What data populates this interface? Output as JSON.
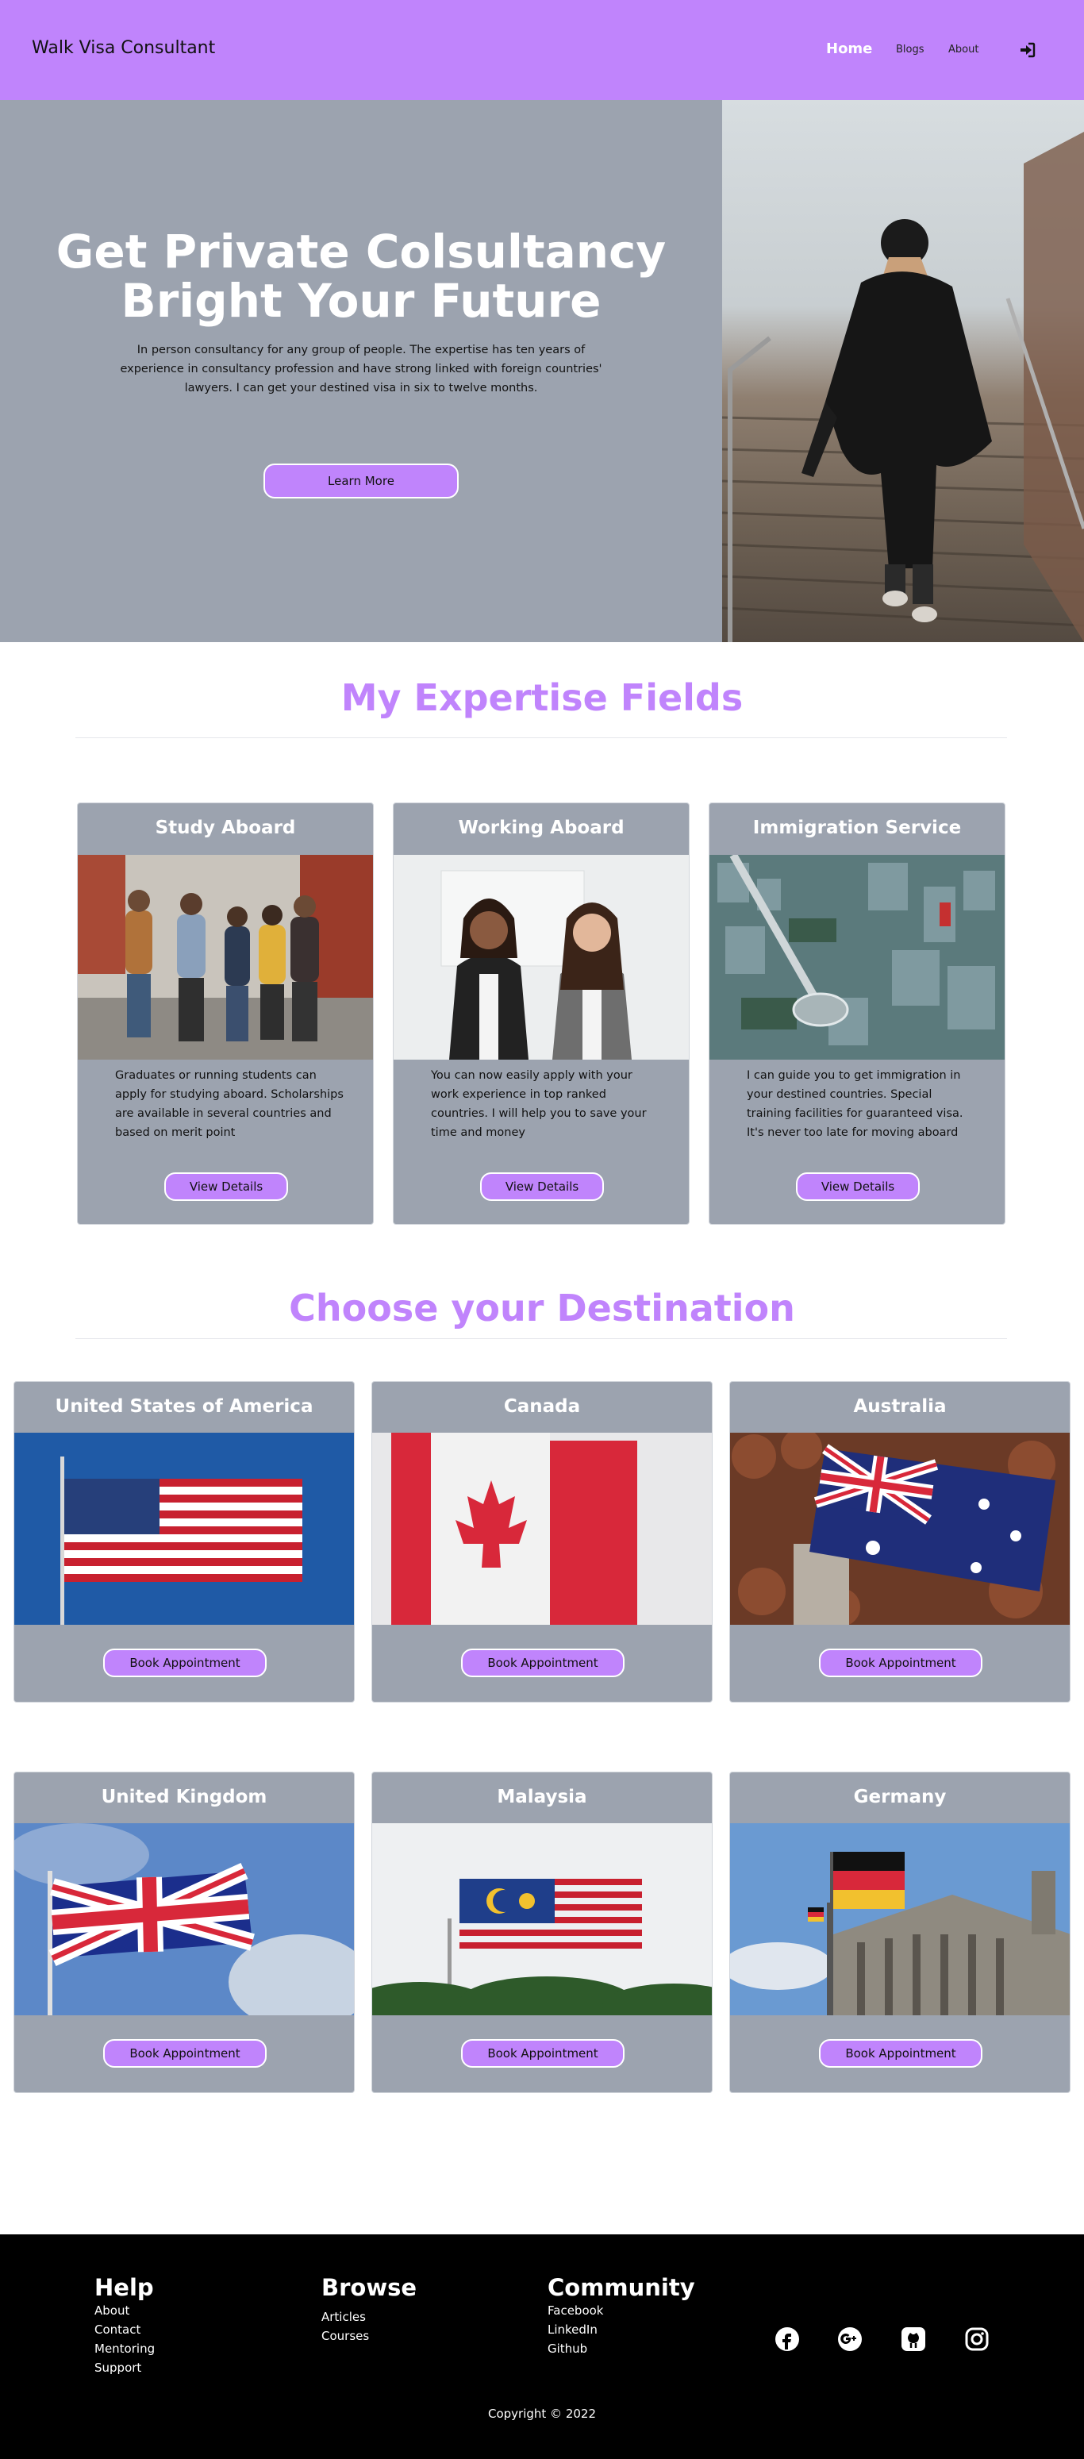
{
  "nav": {
    "brand": "Walk Visa Consultant",
    "links": [
      "Home",
      "Blogs",
      "About"
    ],
    "login_icon": "sign-in-icon"
  },
  "hero": {
    "title_line1": "Get Private Colsultancy",
    "title_line2": "Bright Your Future",
    "description": "In person consultancy for any group of people. The expertise has ten years of experience in consultancy profession and have strong linked with foreign countries' lawyers. I can get your destined visa in six to twelve months.",
    "button": "Learn More"
  },
  "expertise": {
    "heading": "My Expertise Fields",
    "cards": [
      {
        "title": "Study Aboard",
        "text": "Graduates or running students can apply for studying aboard. Scholarships are available in several countries and based on merit point",
        "button": "View Details"
      },
      {
        "title": "Working Aboard",
        "text": "You can now easily apply with your work experience in top ranked countries. I will help you to save your time and money",
        "button": "View Details"
      },
      {
        "title": "Immigration Service",
        "text": "I can guide you to get immigration in your destined countries. Special training facilities for guaranteed visa. It's never too late for moving aboard",
        "button": "View Details"
      }
    ]
  },
  "destinations": {
    "heading": "Choose your Destination",
    "cards": [
      {
        "title": "United States of America",
        "button": "Book Appointment"
      },
      {
        "title": "Canada",
        "button": "Book Appointment"
      },
      {
        "title": "Australia",
        "button": "Book Appointment"
      },
      {
        "title": "United Kingdom",
        "button": "Book Appointment"
      },
      {
        "title": "Malaysia",
        "button": "Book Appointment"
      },
      {
        "title": "Germany",
        "button": "Book Appointment"
      }
    ]
  },
  "footer": {
    "help": {
      "heading": "Help",
      "links": [
        "About",
        "Contact",
        "Mentoring",
        "Support"
      ]
    },
    "browse": {
      "heading": "Browse",
      "links": [
        "Articles",
        "Courses"
      ]
    },
    "community": {
      "heading": "Community",
      "links": [
        "Facebook",
        "LinkedIn",
        "Github"
      ]
    },
    "social_icons": [
      "facebook-icon",
      "google-plus-icon",
      "github-icon",
      "instagram-icon"
    ],
    "copyright": "Copyright © 2022"
  },
  "colors": {
    "accent": "#c084fc",
    "card_bg": "#9ca3af",
    "footer_bg": "#000000"
  }
}
